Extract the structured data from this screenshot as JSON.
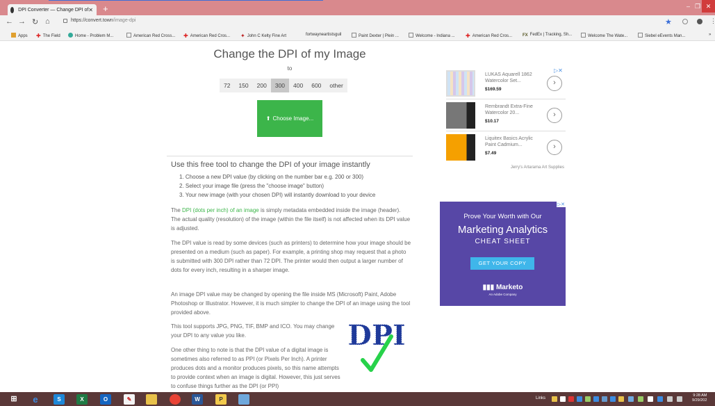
{
  "browser": {
    "tab_title": "DPI Converter — Change DPI of",
    "new_tab": "+",
    "url_host": "https://convert.town",
    "url_path": "/image-dpi",
    "bookmarks": [
      "Apps",
      "The Field",
      "Home - Problem M...",
      "American Red Cross...",
      "American Red Cros...",
      "John C Kelty Fine Art",
      "fortwayneartistsguil",
      "Paint Dexter | Plein ...",
      "Welcome - Indiana ...",
      "American Red Cros...",
      "FedEx | Tracking, Sh...",
      "Welcome The Wate...",
      "Siebel eEvents Man..."
    ]
  },
  "main": {
    "title": "Change the DPI of my Image",
    "to_label": "to",
    "dpi_options": [
      "72",
      "150",
      "200",
      "300",
      "400",
      "600",
      "other"
    ],
    "selected_dpi": "300",
    "choose_button": "Choose Image...",
    "section_heading": "Use this free tool to change the DPI of your image instantly",
    "steps": [
      "1. Choose a new DPI value (by clicking on the number bar e.g. 200 or 300)",
      "2. Select your image file (press the \"choose image\" button)",
      "3. Your new image (with your chosen DPI) will instantly download to your device"
    ],
    "p1_pre": "The ",
    "p1_link": "DPI (dots per inch) of an image",
    "p1_post": " is simply metadata embedded inside the image (header). The actual quality (resolution) of the image (within the file itself) is not affected when its DPI value is adjusted.",
    "p2": "The DPI value is read by some devices (such as printers) to determine how your image should be presented on a medium (such as paper). For example, a printing shop may request that a photo is submitted with 300 DPI rather than 72 DPI. The printer would then output a larger number of dots for every inch, resulting in a sharper image.",
    "p3": "An image DPI value may be changed by opening the file inside MS (Microsoft) Paint, Adobe Photoshop or Illustrator. However, it is much simpler to change the DPI of an image using the tool provided above.",
    "p4": "This tool supports JPG, PNG, TIF, BMP and ICO. You may change your DPI to any value you like.",
    "p5": "One other thing to note is that the DPI value of a digital image is sometimes also referred to as PPI (or Pixels Per Inch). A printer produces dots and a monitor produces pixels, so this name attempts to provide context when an image is digital. However, this just serves to confuse things further as the DPI (or PPI)",
    "logo_text": "DPI"
  },
  "ads": {
    "products": [
      {
        "name": "LUKAS Aquarell 1862 Watercolor Set...",
        "price": "$169.59"
      },
      {
        "name": "Rembrandt Extra-Fine Watercolor 20...",
        "price": "$10.17"
      },
      {
        "name": "Liquitex Basics Acrylic Paint Cadmium...",
        "price": "$7.49"
      }
    ],
    "advertiser": "Jerry's Artarama Art Supplies",
    "banner": {
      "line1": "Prove Your Worth with Our",
      "line2": "Marketing Analytics",
      "line3": "CHEAT SHEET",
      "button": "GET YOUR COPY",
      "brand": "Marketo",
      "brand_sub": "An Adobe Company"
    }
  },
  "taskbar": {
    "links_label": "Links",
    "time": "9:28 AM",
    "date": "9/29/202"
  },
  "colors": {
    "titlebar": "#d9898d",
    "accent_green": "#3cb54a",
    "banner": "#5747a6",
    "taskbar": "#5a3838"
  }
}
